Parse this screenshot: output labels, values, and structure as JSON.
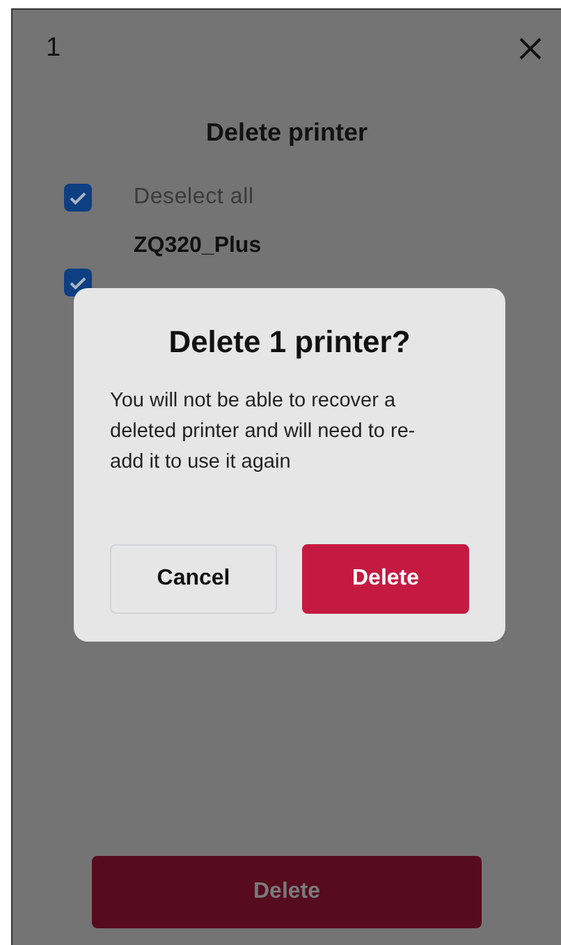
{
  "header": {
    "count": "1"
  },
  "title": "Delete printer",
  "select_all": {
    "label": "Deselect all",
    "checked": true
  },
  "printers": [
    {
      "name": "ZQ320_Plus",
      "checked": true
    }
  ],
  "delete_button": {
    "label": "Delete",
    "disabled": true
  },
  "dialog": {
    "title": "Delete 1 printer?",
    "message": "You will not be able to recover a deleted printer and will need to re-add it to use it again",
    "buttons": [
      {
        "label": "Cancel",
        "kind": "secondary"
      },
      {
        "label": "Delete",
        "kind": "destructive"
      }
    ]
  }
}
